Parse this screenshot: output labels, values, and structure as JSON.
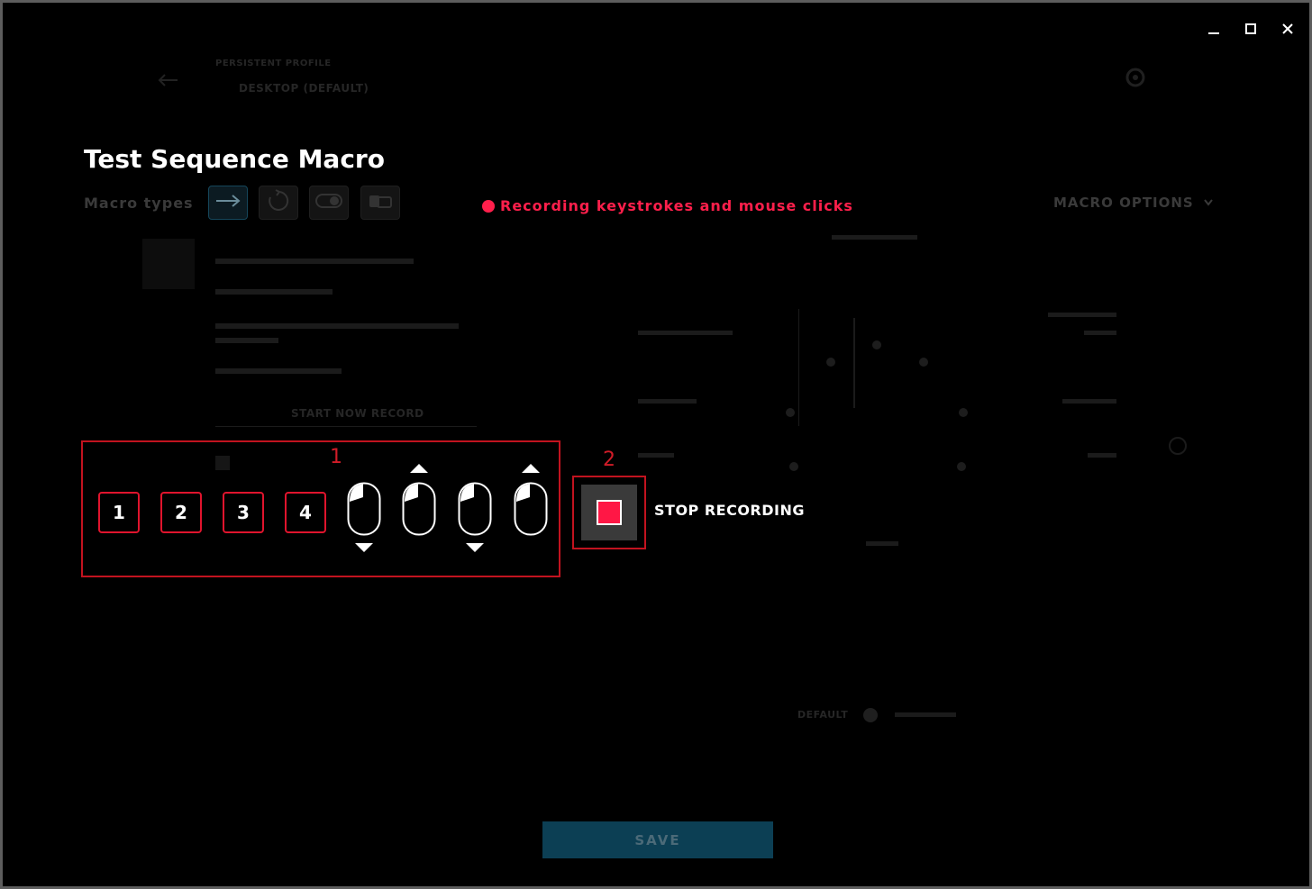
{
  "window": {
    "minimize_icon": "minimize-icon",
    "maximize_icon": "maximize-icon",
    "close_icon": "close-icon"
  },
  "background": {
    "profile_label": "PERSISTENT PROFILE",
    "profile_name": "DESKTOP (DEFAULT)",
    "start_now_label": "START NOW RECORD",
    "delay_value": "DEFAULT",
    "back_icon": "back-arrow-icon",
    "settings_icon": "gear-icon"
  },
  "page": {
    "title": "Test Sequence Macro"
  },
  "macro_types": {
    "label": "Macro types",
    "types": [
      {
        "icon": "no-repeat-arrow-icon",
        "active": true
      },
      {
        "icon": "repeat-while-holding-icon",
        "active": false
      },
      {
        "icon": "toggle-icon",
        "active": false
      },
      {
        "icon": "sequence-icon",
        "active": false
      }
    ]
  },
  "recording": {
    "status_text": "Recording keystrokes and mouse clicks",
    "accent_color": "#ff1f4b"
  },
  "macro_options": {
    "label": "MACRO OPTIONS",
    "icon": "chevron-down-icon"
  },
  "callouts": {
    "one": "1",
    "two": "2"
  },
  "sequence": {
    "keys": [
      "1",
      "2",
      "3",
      "4"
    ],
    "mouse_events": [
      {
        "icon": "mouse-left-click-icon",
        "direction": "down"
      },
      {
        "icon": "mouse-left-click-icon",
        "direction": "up"
      },
      {
        "icon": "mouse-left-click-icon",
        "direction": "down"
      },
      {
        "icon": "mouse-left-click-icon",
        "direction": "up"
      }
    ]
  },
  "stop": {
    "label": "STOP RECORDING",
    "icon": "stop-square-icon"
  },
  "footer": {
    "save_label": "SAVE",
    "save_color": "#0c3f54"
  }
}
